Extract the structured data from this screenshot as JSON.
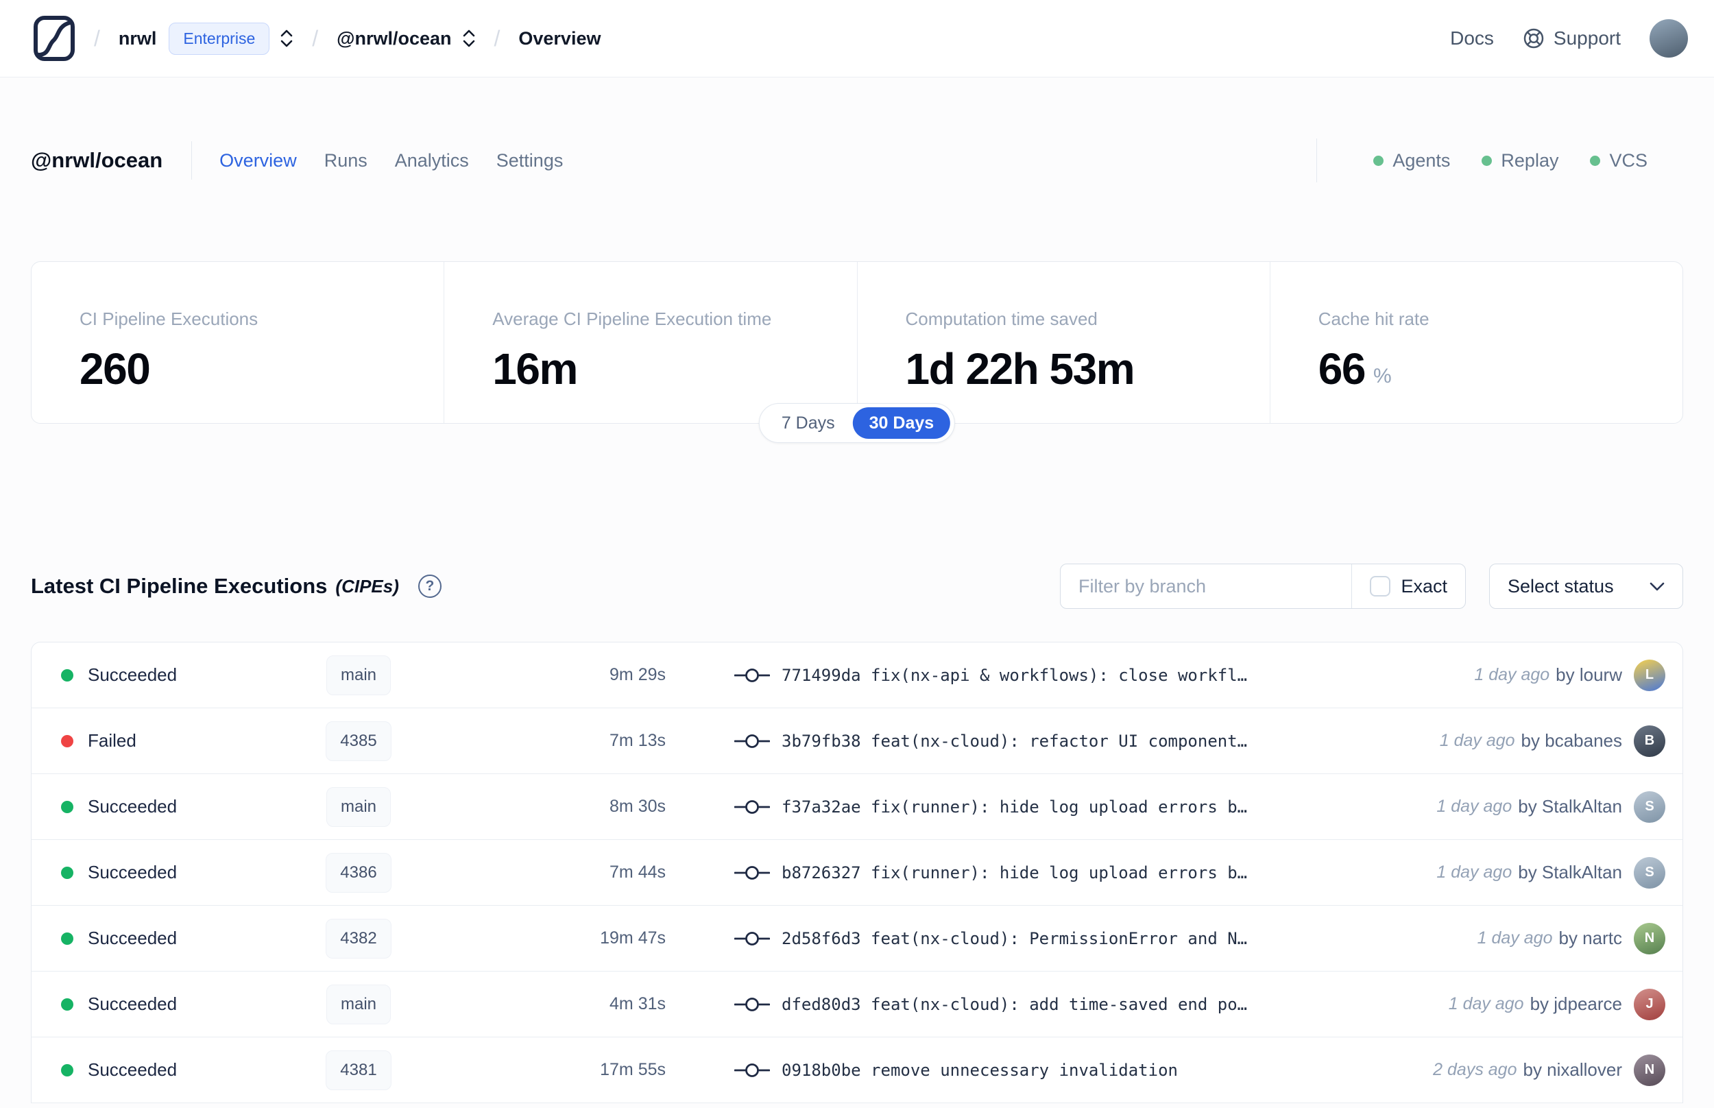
{
  "topbar": {
    "org": "nrwl",
    "plan_badge": "Enterprise",
    "workspace": "@nrwl/ocean",
    "page": "Overview",
    "docs": "Docs",
    "support": "Support",
    "avatar_colors": [
      "#93a7ba",
      "#4e5e6e"
    ]
  },
  "header": {
    "title": "@nrwl/ocean",
    "tabs": [
      {
        "label": "Overview",
        "active": true
      },
      {
        "label": "Runs",
        "active": false
      },
      {
        "label": "Analytics",
        "active": false
      },
      {
        "label": "Settings",
        "active": false
      }
    ],
    "services": [
      {
        "label": "Agents",
        "status": "online"
      },
      {
        "label": "Replay",
        "status": "online"
      },
      {
        "label": "VCS",
        "status": "online"
      }
    ]
  },
  "stats": {
    "cards": [
      {
        "label": "CI Pipeline Executions",
        "value": "260",
        "suffix": ""
      },
      {
        "label": "Average CI Pipeline Execution time",
        "value": "16m",
        "suffix": ""
      },
      {
        "label": "Computation time saved",
        "value": "1d 22h 53m",
        "suffix": ""
      },
      {
        "label": "Cache hit rate",
        "value": "66",
        "suffix": "%"
      }
    ],
    "range": {
      "options": [
        "7 Days",
        "30 Days"
      ],
      "selected": "30 Days"
    }
  },
  "cipe": {
    "title": "Latest CI Pipeline Executions",
    "title_suffix": "(CIPEs)",
    "filter_placeholder": "Filter by branch",
    "exact_label": "Exact",
    "status_button": "Select status",
    "rows": [
      {
        "status": "Succeeded",
        "dot": "success",
        "branch": "main",
        "duration": "9m 29s",
        "hash": "771499da",
        "message": "fix(nx-api & workflows): close workfl…",
        "time": "1 day ago",
        "author": "by lourw",
        "avatar_initial": "L",
        "avatar_colors": [
          "#f6d14e",
          "#4a77d6"
        ]
      },
      {
        "status": "Failed",
        "dot": "failed",
        "branch": "4385",
        "duration": "7m 13s",
        "hash": "3b79fb38",
        "message": "feat(nx-cloud): refactor UI component…",
        "time": "1 day ago",
        "author": "by bcabanes",
        "avatar_initial": "B",
        "avatar_colors": [
          "#6b7686",
          "#313b49"
        ]
      },
      {
        "status": "Succeeded",
        "dot": "success",
        "branch": "main",
        "duration": "8m 30s",
        "hash": "f37a32ae",
        "message": "fix(runner): hide log upload errors b…",
        "time": "1 day ago",
        "author": "by StalkAltan",
        "avatar_initial": "S",
        "avatar_colors": [
          "#bcc9d6",
          "#7e93a6"
        ]
      },
      {
        "status": "Succeeded",
        "dot": "success",
        "branch": "4386",
        "duration": "7m 44s",
        "hash": "b8726327",
        "message": "fix(runner): hide log upload errors b…",
        "time": "1 day ago",
        "author": "by StalkAltan",
        "avatar_initial": "S",
        "avatar_colors": [
          "#bcc9d6",
          "#7e93a6"
        ]
      },
      {
        "status": "Succeeded",
        "dot": "success",
        "branch": "4382",
        "duration": "19m 47s",
        "hash": "2d58f6d3",
        "message": "feat(nx-cloud): PermissionError and N…",
        "time": "1 day ago",
        "author": "by nartc",
        "avatar_initial": "N",
        "avatar_colors": [
          "#a8c98e",
          "#56804f"
        ]
      },
      {
        "status": "Succeeded",
        "dot": "success",
        "branch": "main",
        "duration": "4m 31s",
        "hash": "dfed80d3",
        "message": "feat(nx-cloud): add time-saved end po…",
        "time": "1 day ago",
        "author": "by jdpearce",
        "avatar_initial": "J",
        "avatar_colors": [
          "#d2908c",
          "#a2403e"
        ]
      },
      {
        "status": "Succeeded",
        "dot": "success",
        "branch": "4381",
        "duration": "17m 55s",
        "hash": "0918b0be",
        "message": "remove unnecessary invalidation",
        "time": "2 days ago",
        "author": "by nixallover",
        "avatar_initial": "N",
        "avatar_colors": [
          "#9b8f9b",
          "#574b57"
        ]
      }
    ]
  },
  "colors": {
    "accent": "#2d63e0",
    "success_dot": "#16b364",
    "failed_dot": "#ef4444",
    "service_dot": "#67c08f"
  },
  "icons": {
    "logo": "nx-cloud-logo",
    "breadcrumb_expand": "unfold-vertical",
    "support": "lifebuoy",
    "help": "question-circle",
    "commit": "git-commit",
    "select": "chevron-down",
    "exact": "checkbox-unchecked"
  }
}
